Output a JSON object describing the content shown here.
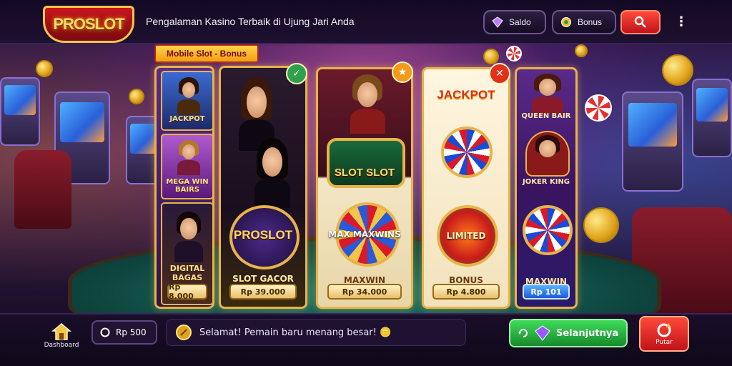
{
  "header": {
    "logo_text": "PROSLOT",
    "tagline": "Pengalaman Kasino Terbaik di Ujung Jari Anda",
    "balance_label": "Saldo",
    "bonus_label": "Bonus",
    "menu_glyph": "⋮"
  },
  "promo": {
    "label": "Mobile Slot - Bonus"
  },
  "cards": [
    {
      "minis": [
        {
          "label": "JACKPOT"
        },
        {
          "label": "MEGA WIN BAIRS"
        },
        {
          "label": "DIGITAL BAGAS"
        }
      ],
      "value": "Rp 8.000"
    },
    {
      "title": "PROSLOT",
      "sub": "SLOT GACOR",
      "value": "Rp 39.000",
      "corner_glyph": "✓"
    },
    {
      "title": "SLOT SLOT",
      "sub": "MAXWIN",
      "logo_text": "MAX MAXWINS",
      "value": "Rp 34.000",
      "corner_glyph": "★"
    },
    {
      "title": "JACKPOT",
      "sub": "BONUS",
      "logo_text": "LIMITED",
      "value": "Rp 4.800",
      "corner_glyph": "✕"
    },
    {
      "top_label": "QUEEN BAIR",
      "mid_label": "JOKER KING",
      "sub": "MAXWIN",
      "value": "Rp 101"
    }
  ],
  "bottom": {
    "home_label": "Dashboard",
    "bet_label": "Rp 500",
    "ticker_text": "Selamat! Pemain baru menang besar! 🪙",
    "play_label": "Selanjutnya",
    "spin_label": "Putar"
  }
}
